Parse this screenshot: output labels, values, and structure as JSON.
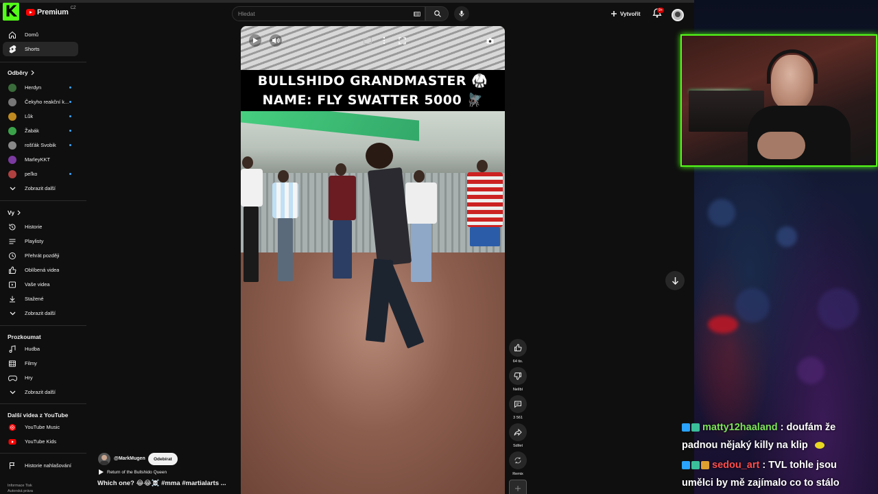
{
  "header": {
    "brand": "Premium",
    "brand_country": "CZ",
    "search_placeholder": "Hledat",
    "create_label": "Vytvořit",
    "notifications_badge": "9+"
  },
  "sidebar": {
    "main": [
      {
        "label": "Domů",
        "icon": "home-icon"
      },
      {
        "label": "Shorts",
        "icon": "shorts-icon",
        "active": true
      }
    ],
    "subscriptions_heading": "Odběry",
    "subscriptions": [
      {
        "label": "Herdyn",
        "color": "#3a6b3a"
      },
      {
        "label": "Čekyho reakční k...",
        "color": "#777777"
      },
      {
        "label": "Lůk",
        "color": "#c08a20"
      },
      {
        "label": "Žabák",
        "color": "#3aa34a"
      },
      {
        "label": "rošťák Svobik",
        "color": "#888888"
      },
      {
        "label": "MarleyKKT",
        "color": "#7a3aa0"
      },
      {
        "label": "peľko",
        "color": "#b04040"
      }
    ],
    "subscriptions_more": "Zobrazit další",
    "you_heading": "Vy",
    "you": [
      {
        "label": "Historie",
        "icon": "history-icon"
      },
      {
        "label": "Playlisty",
        "icon": "playlist-icon"
      },
      {
        "label": "Přehrát později",
        "icon": "clock-icon"
      },
      {
        "label": "Oblíbená videa",
        "icon": "like-icon"
      },
      {
        "label": "Vaše videa",
        "icon": "video-icon"
      },
      {
        "label": "Stažené",
        "icon": "download-icon"
      }
    ],
    "you_more": "Zobrazit další",
    "explore_heading": "Prozkoumat",
    "explore": [
      {
        "label": "Hudba",
        "icon": "music-icon"
      },
      {
        "label": "Filmy",
        "icon": "film-icon"
      },
      {
        "label": "Hry",
        "icon": "gamepad-icon"
      }
    ],
    "explore_more": "Zobrazit další",
    "more_yt_heading": "Další videa z YouTube",
    "more_yt": [
      {
        "label": "YouTube Music"
      },
      {
        "label": "YouTube Kids"
      }
    ],
    "report_history": "Historie nahlašování",
    "footer": [
      "Informace  Tisk",
      "Autorská práva"
    ]
  },
  "short": {
    "caption_line1": "BULLSHIDO GRANDMASTER 🥋",
    "caption_line2": "NAME: FLY SWATTER 5000 🪰",
    "channel_handle": "@MarkMugen",
    "subscribe_label": "Odebírat",
    "sound_title": "Return of the Bullshido Queen",
    "title": "Which one? 😂😂☠️ #mma #martialarts ..."
  },
  "actions": {
    "like_count": "64 tis.",
    "dislike_label": "Nelíbí",
    "comment_count": "3 561",
    "share_label": "Sdílet",
    "remix_label": "Remix"
  },
  "chat": [
    {
      "user": "matty12haaland",
      "text": ": doufám že",
      "cont": "padnou nějaký killy na klip"
    },
    {
      "user": "sedou_art",
      "text": ": TVL tohle jsou",
      "cont": "umělci by mě zajímalo co to stálo"
    }
  ],
  "colors": {
    "accent_green": "#53fc18",
    "yt_red": "#ff0000",
    "link_blue": "#3ea6ff"
  }
}
